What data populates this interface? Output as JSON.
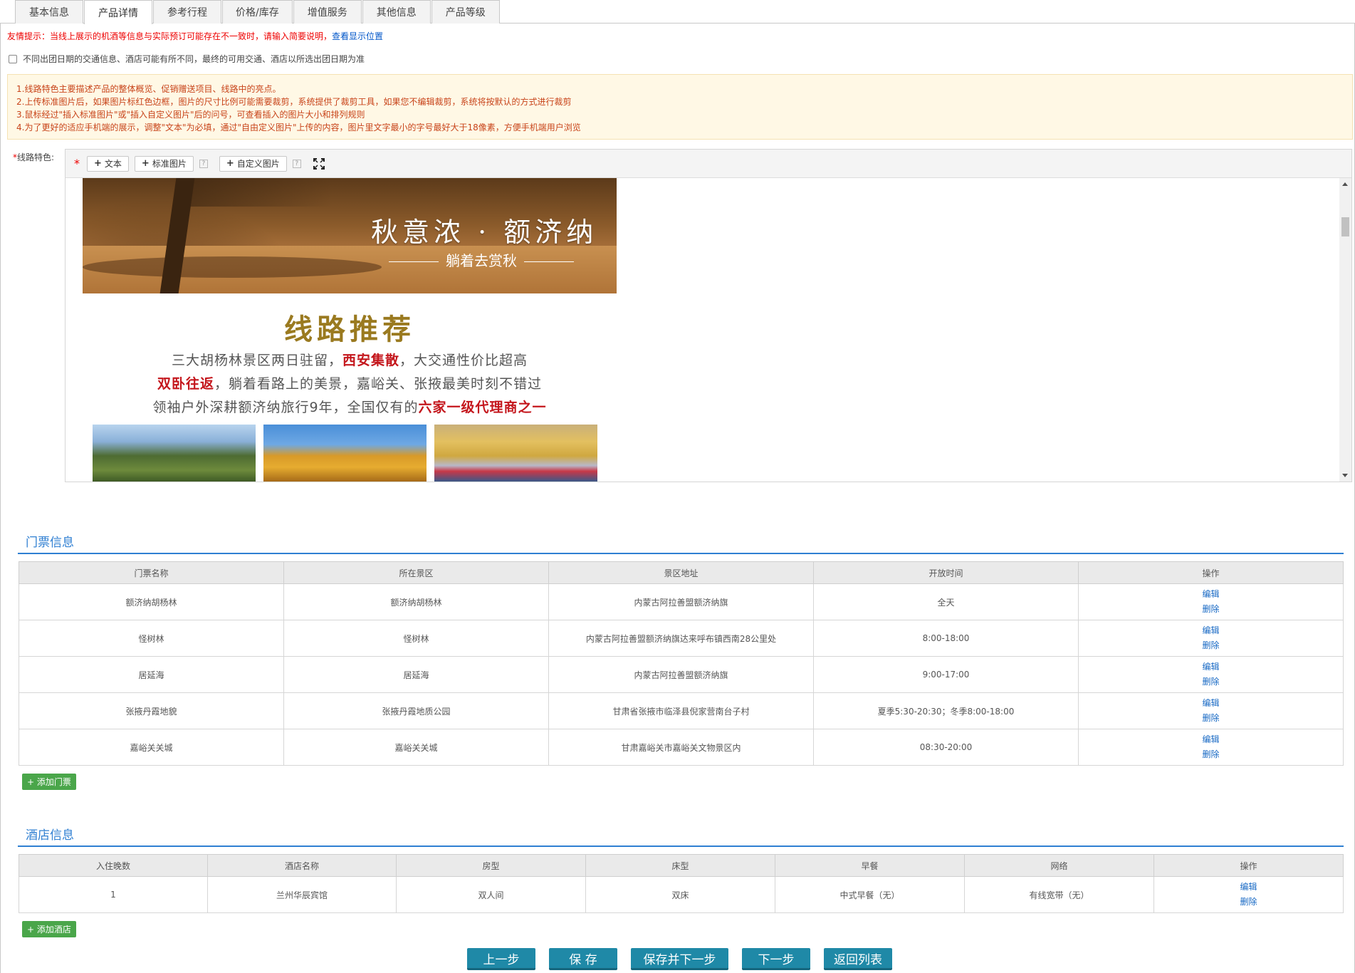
{
  "tabs": [
    {
      "label": "基本信息"
    },
    {
      "label": "产品详情"
    },
    {
      "label": "参考行程"
    },
    {
      "label": "价格/库存"
    },
    {
      "label": "增值服务"
    },
    {
      "label": "其他信息"
    },
    {
      "label": "产品等级"
    }
  ],
  "active_tab": "产品详情",
  "tip": {
    "text": "友情提示：当线上展示的机酒等信息与实际预订可能存在不一致时，请输入简要说明，",
    "link": "查看显示位置"
  },
  "check_option": {
    "label": "不同出团日期的交通信息、酒店可能有所不同，最终的可用交通、酒店以所选出团日期为准",
    "checked": false
  },
  "notice": [
    "1.线路特色主要描述产品的整体概览、促销赠送项目、线路中的亮点。",
    "2.上传标准图片后，如果图片标红色边框，图片的尺寸比例可能需要裁剪，系统提供了裁剪工具，如果您不编辑裁剪，系统将按默认的方式进行裁剪",
    "3.鼠标经过\"插入标准图片\"或\"插入自定义图片\"后的问号，可查看插入的图片大小和排列规则",
    "4.为了更好的适应手机端的展示，调整\"文本\"为必填，通过\"自由定义图片\"上传的内容，图片里文字最小的字号最好大于18像素，方便手机端用户浏览"
  ],
  "editor": {
    "label_star": "*",
    "label": "线路特色:",
    "required_mark": "*",
    "buttons": {
      "text": "文本",
      "std_image": "标准图片",
      "custom_image": "自定义图片",
      "help": "?"
    },
    "banner_title": "秋意浓 · 额济纳",
    "banner_subtitle": "躺着去赏秋",
    "route_title": "线路推荐",
    "line1": {
      "a": "三大胡杨林景区两日驻留，",
      "b": "西安集散",
      "c": "，大交通性价比超高"
    },
    "line2": {
      "a": "双卧往返",
      "b": "，躺着看路上的美景，嘉峪关、张掖最美时刻不错过"
    },
    "line3": {
      "a": "领袖户外深耕额济纳旅行9年，全国仅有的",
      "b": "六家一级代理商之一"
    }
  },
  "tickets": {
    "title": "门票信息",
    "columns": [
      "门票名称",
      "所在景区",
      "景区地址",
      "开放时间",
      "操作"
    ],
    "rows": [
      [
        "额济纳胡杨林",
        "额济纳胡杨林",
        "内蒙古阿拉善盟额济纳旗",
        "全天"
      ],
      [
        "怪树林",
        "怪树林",
        "内蒙古阿拉善盟额济纳旗达来呼布镇西南28公里处",
        "8:00-18:00"
      ],
      [
        "居延海",
        "居延海",
        "内蒙古阿拉善盟额济纳旗",
        "9:00-17:00"
      ],
      [
        "张掖丹霞地貌",
        "张掖丹霞地质公园",
        "甘肃省张掖市临泽县倪家营南台子村",
        "夏季5:30-20:30；冬季8:00-18:00"
      ],
      [
        "嘉峪关关城",
        "嘉峪关关城",
        "甘肃嘉峪关市嘉峪关文物景区内",
        "08:30-20:00"
      ]
    ],
    "edit": "编辑",
    "delete": "删除",
    "add_button": "+ 添加门票"
  },
  "hotels": {
    "title": "酒店信息",
    "columns": [
      "入住晚数",
      "酒店名称",
      "房型",
      "床型",
      "早餐",
      "网络",
      "操作"
    ],
    "rows": [
      [
        "1",
        "兰州华辰宾馆",
        "双人间",
        "双床",
        "中式早餐（无）",
        "有线宽带（无）"
      ]
    ],
    "edit": "编辑",
    "delete": "删除",
    "add_button": "+ 添加酒店"
  },
  "bottom_buttons": {
    "prev": "上一步",
    "save": "保 存",
    "save_next": "保存并下一步",
    "next": "下一步",
    "back": "返回列表"
  },
  "colors": {
    "accent": "#2f7fd2",
    "warning_text": "#c8441a",
    "tip_red": "#e00000",
    "button": "#1f89a7",
    "add_green": "#4aa64a"
  }
}
